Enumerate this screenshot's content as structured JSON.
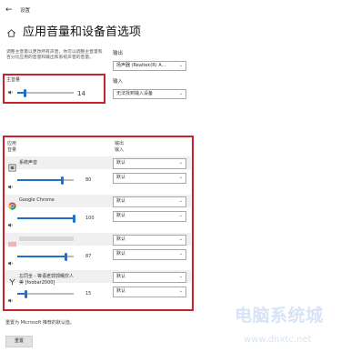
{
  "window": {
    "title": "设置",
    "back_glyph": "←"
  },
  "header": {
    "title": "应用音量和设备首选项"
  },
  "description": "调整主音量以更改所有声音。你可以调整主音量和百分比应用的音量和输出和系统声音的音量。",
  "master": {
    "label": "主音量",
    "value": "14",
    "level_percent": 14
  },
  "output": {
    "label": "输出",
    "selected": "扬声器 (Realtek(R) A..."
  },
  "input": {
    "label": "输入",
    "selected": "无法找到输入设备"
  },
  "apps_header": {
    "app_col": "应用",
    "volume_col": "音量",
    "output_col": "输出",
    "input_col": "输入"
  },
  "apps": [
    {
      "name": "系统声音",
      "value": "80",
      "level_percent": 80,
      "output": "默认",
      "input": "默认",
      "icon": "system-sounds-icon"
    },
    {
      "name": "Google Chrome",
      "value": "100",
      "level_percent": 100,
      "output": "默认",
      "input": "默认",
      "icon": "chrome-icon"
    },
    {
      "name": "",
      "value": "87",
      "level_percent": 87,
      "output": "默认",
      "input": "默认",
      "icon": "blurred-app-icon"
    },
    {
      "name": "左同全 - 等语老郭郭曙炊人",
      "name2": "美 [foobar2000]",
      "value": "15",
      "level_percent": 15,
      "output": "默认",
      "input": "默认",
      "icon": "foobar-icon"
    }
  ],
  "reset": {
    "text": "重置为 Microsoft 推荐的默认值。",
    "button": "重置"
  },
  "watermark": {
    "main": "电脑系统城",
    "url": "www.dnxtc.net"
  },
  "colors": {
    "accent": "#1f6fd1",
    "highlight": "#c8232c"
  }
}
